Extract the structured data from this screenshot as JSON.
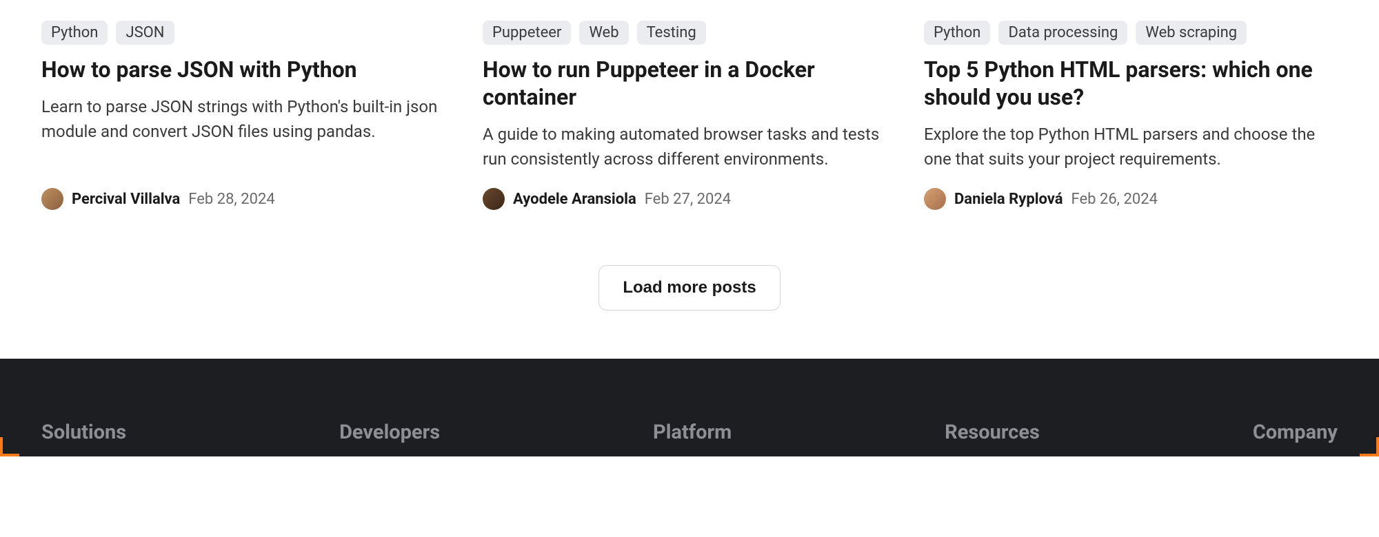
{
  "articles": [
    {
      "tags": [
        "Python",
        "JSON"
      ],
      "title": "How to parse JSON with Python",
      "description": "Learn to parse JSON strings with Python's built-in json module and convert JSON files using pandas.",
      "author": "Percival Villalva",
      "date": "Feb 28, 2024"
    },
    {
      "tags": [
        "Puppeteer",
        "Web",
        "Testing"
      ],
      "title": "How to run Puppeteer in a Docker container",
      "description": "A guide to making automated browser tasks and tests run consistently across different environments.",
      "author": "Ayodele Aransiola",
      "date": "Feb 27, 2024"
    },
    {
      "tags": [
        "Python",
        "Data processing",
        "Web scraping"
      ],
      "title": "Top 5 Python HTML parsers: which one should you use?",
      "description": "Explore the top Python HTML parsers and choose the one that suits your project requirements.",
      "author": "Daniela Ryplová",
      "date": "Feb 26, 2024"
    }
  ],
  "load_more_label": "Load more posts",
  "footer": {
    "columns": [
      "Solutions",
      "Developers",
      "Platform",
      "Resources",
      "Company"
    ]
  }
}
